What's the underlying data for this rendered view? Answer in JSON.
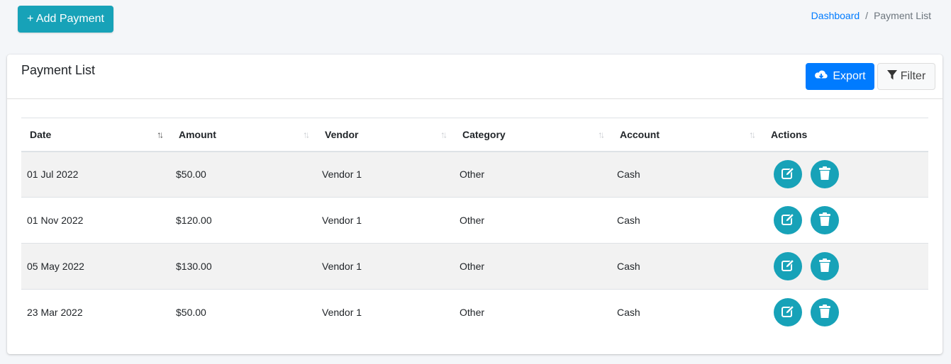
{
  "header": {
    "add_button_label": "+ Add Payment",
    "breadcrumb": {
      "home": "Dashboard",
      "separator": "/",
      "current": "Payment List"
    }
  },
  "card": {
    "title": "Payment List",
    "export_label": "Export",
    "filter_label": "Filter"
  },
  "table": {
    "columns": [
      "Date",
      "Amount",
      "Vendor",
      "Category",
      "Account",
      "Actions"
    ],
    "rows": [
      {
        "date": "01 Jul 2022",
        "amount": "$50.00",
        "vendor": "Vendor 1",
        "category": "Other",
        "account": "Cash"
      },
      {
        "date": "01 Nov 2022",
        "amount": "$120.00",
        "vendor": "Vendor 1",
        "category": "Other",
        "account": "Cash"
      },
      {
        "date": "05 May 2022",
        "amount": "$130.00",
        "vendor": "Vendor 1",
        "category": "Other",
        "account": "Cash"
      },
      {
        "date": "23 Mar 2022",
        "amount": "$50.00",
        "vendor": "Vendor 1",
        "category": "Other",
        "account": "Cash"
      }
    ],
    "sort_icon": "↑↓",
    "row_actions": [
      "edit-icon",
      "trash-icon"
    ]
  },
  "colors": {
    "info": "#17a2b8",
    "primary": "#007bff",
    "stripe": "#f2f2f2"
  }
}
